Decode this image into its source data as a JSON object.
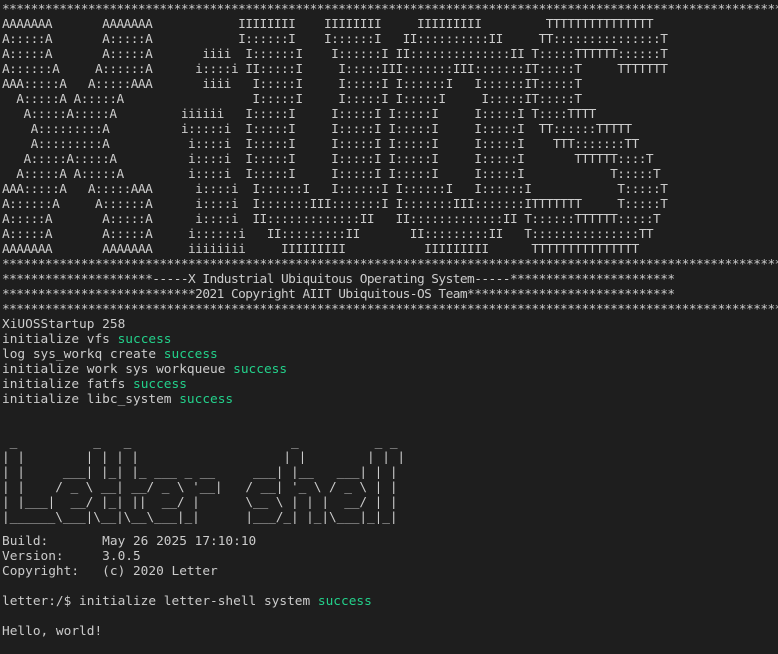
{
  "banner": [
    "***************************************************************************************************************",
    "AAAAAAA       AAAAAAA            IIIIIIII    IIIIIIII     IIIIIIIII         TTTTTTTTTTTTTTT",
    "A:::::A       A:::::A            I::::::I    I::::::I   II::::::::::II     TT:::::::::::::::T",
    "A:::::A       A:::::A       iiii  I::::::I    I::::::I II::::::::::::::II T:::::TTTTTT::::::T",
    "A::::::A     A::::::A      i::::i II:::::I     I:::::III:::::::III:::::::IT:::::T     TTTTTTT",
    "AAA:::::A   A:::::AAA       iiii   I:::::I     I:::::I I::::::I   I::::::IT:::::T",
    "  A:::::A A:::::A                  I:::::I     I:::::I I:::::I     I:::::IT:::::T",
    "   A:::::A:::::A         iiiiii   I:::::I     I:::::I I:::::I     I:::::I T::::TTTT",
    "    A:::::::::A          i:::::i  I:::::I     I:::::I I:::::I     I:::::I  TT::::::TTTTT",
    "    A:::::::::A           i::::i  I:::::I     I:::::I I:::::I     I:::::I    TTT:::::::TT",
    "   A:::::A:::::A          i::::i  I:::::I     I:::::I I:::::I     I:::::I       TTTTTT::::T",
    "  A:::::A A:::::A         i::::i  I:::::I     I:::::I I:::::I     I:::::I            T:::::T",
    "AAA:::::A   A:::::AAA      i::::i  I::::::I   I::::::I I::::::I   I::::::I            T:::::T",
    "A::::::A     A::::::A      i::::i  I:::::::III:::::::I I:::::::III:::::::ITTTTTTT     T:::::T",
    "A:::::A       A:::::A      i::::i  II:::::::::::::II   II:::::::::::::II T::::::TTTTTT:::::T",
    "A:::::A       A:::::A     i::::::i   II:::::::::II       II:::::::::II   T:::::::::::::::TT",
    "AAAAAAA       AAAAAAA     iiiiiiii     IIIIIIIII           IIIIIIIII      TTTTTTTTTTTTTTT",
    "***************************************************************************************************************",
    "*********************-----X Industrial Ubiquitous Operating System-----***********************",
    "***************************2021 Copyright AIIT Ubiquitous-OS Team*****************************",
    "***************************************************************************************************************"
  ],
  "boot": [
    {
      "text": "XiUOSStartup 258",
      "status": ""
    },
    {
      "text": "initialize vfs ",
      "status": "success"
    },
    {
      "text": "log sys_workq create ",
      "status": "success"
    },
    {
      "text": "initialize work sys workqueue ",
      "status": "success"
    },
    {
      "text": "initialize fatfs ",
      "status": "success"
    },
    {
      "text": "initialize libc_system ",
      "status": "success"
    }
  ],
  "logo": [
    " _          _   _                     _          _ _",
    "| |        | | | |                   | |        | | |",
    "| |     ___| |_| |_ ___ _ __     ___| |__   ___| | |",
    "| |    / _ \\ __| __/ _ \\ '__|   / __| '_ \\ / _ \\ | |",
    "| |___|  __/ |_| ||  __/ |      \\__ \\ | | |  __/ | |",
    "|______\\___|\\__|\\__\\___|_|      |___/_| |_|\\___|_|_|"
  ],
  "info": [
    "Build:       May 26 2025 17:10:10",
    "Version:     3.0.5",
    "Copyright:   (c) 2020 Letter"
  ],
  "shell": {
    "prompt": "letter:/$ ",
    "init_text": "initialize letter-shell system ",
    "init_status": "success",
    "hello": "Hello, world!"
  },
  "colors": {
    "background": "#1e1e1e",
    "text": "#cccccc",
    "success": "#23d18b"
  }
}
